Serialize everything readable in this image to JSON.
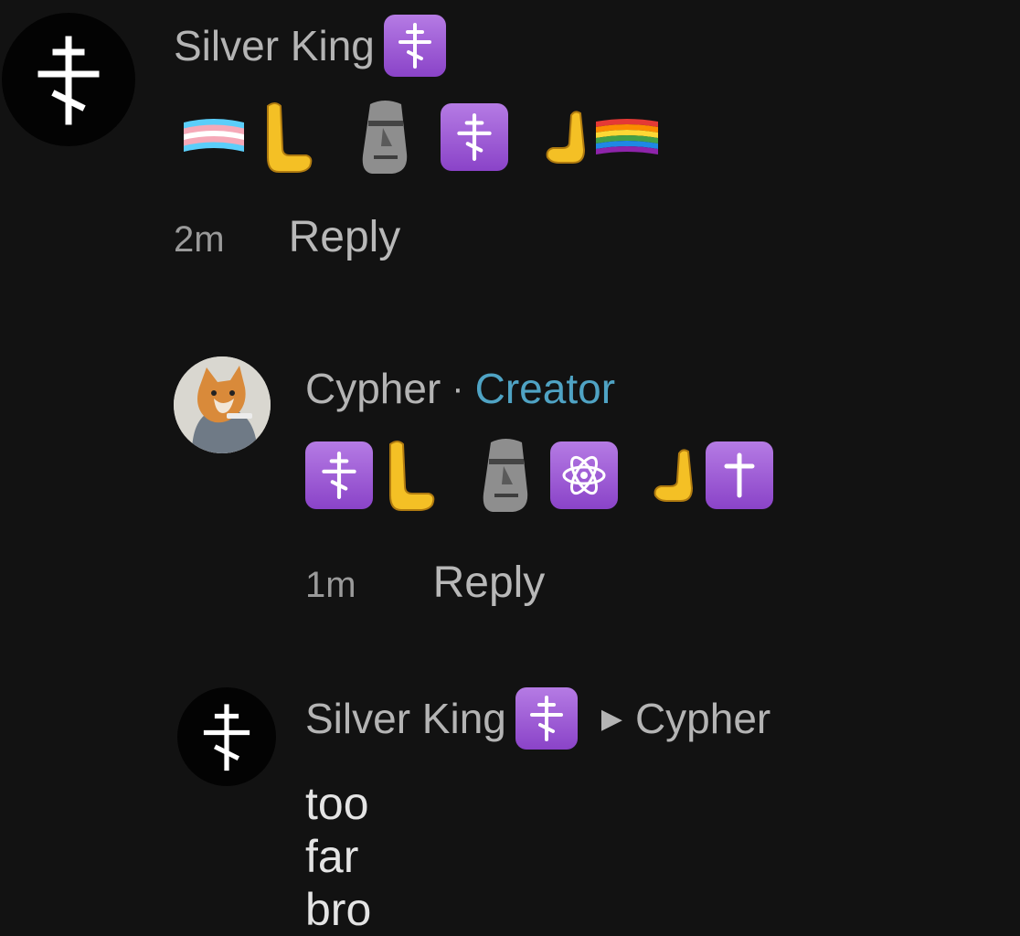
{
  "comments": [
    {
      "author": "Silver King",
      "time": "2m",
      "reply_label": "Reply",
      "emojis": [
        "trans-flag",
        "left-hand",
        "moai",
        "orthodox-cross-tile",
        "right-hand",
        "rainbow-flag"
      ]
    },
    {
      "author": "Cypher",
      "separator": "·",
      "role": "Creator",
      "time": "1m",
      "reply_label": "Reply",
      "emojis": [
        "orthodox-cross-tile",
        "left-hand",
        "moai",
        "atom-tile",
        "right-hand",
        "latin-cross-tile"
      ]
    },
    {
      "author": "Silver King",
      "reply_to": "Cypher",
      "text": "too far bro"
    }
  ],
  "colors": {
    "background": "#121212",
    "creator": "#4fa3c4",
    "badge": "#9b55d4"
  }
}
